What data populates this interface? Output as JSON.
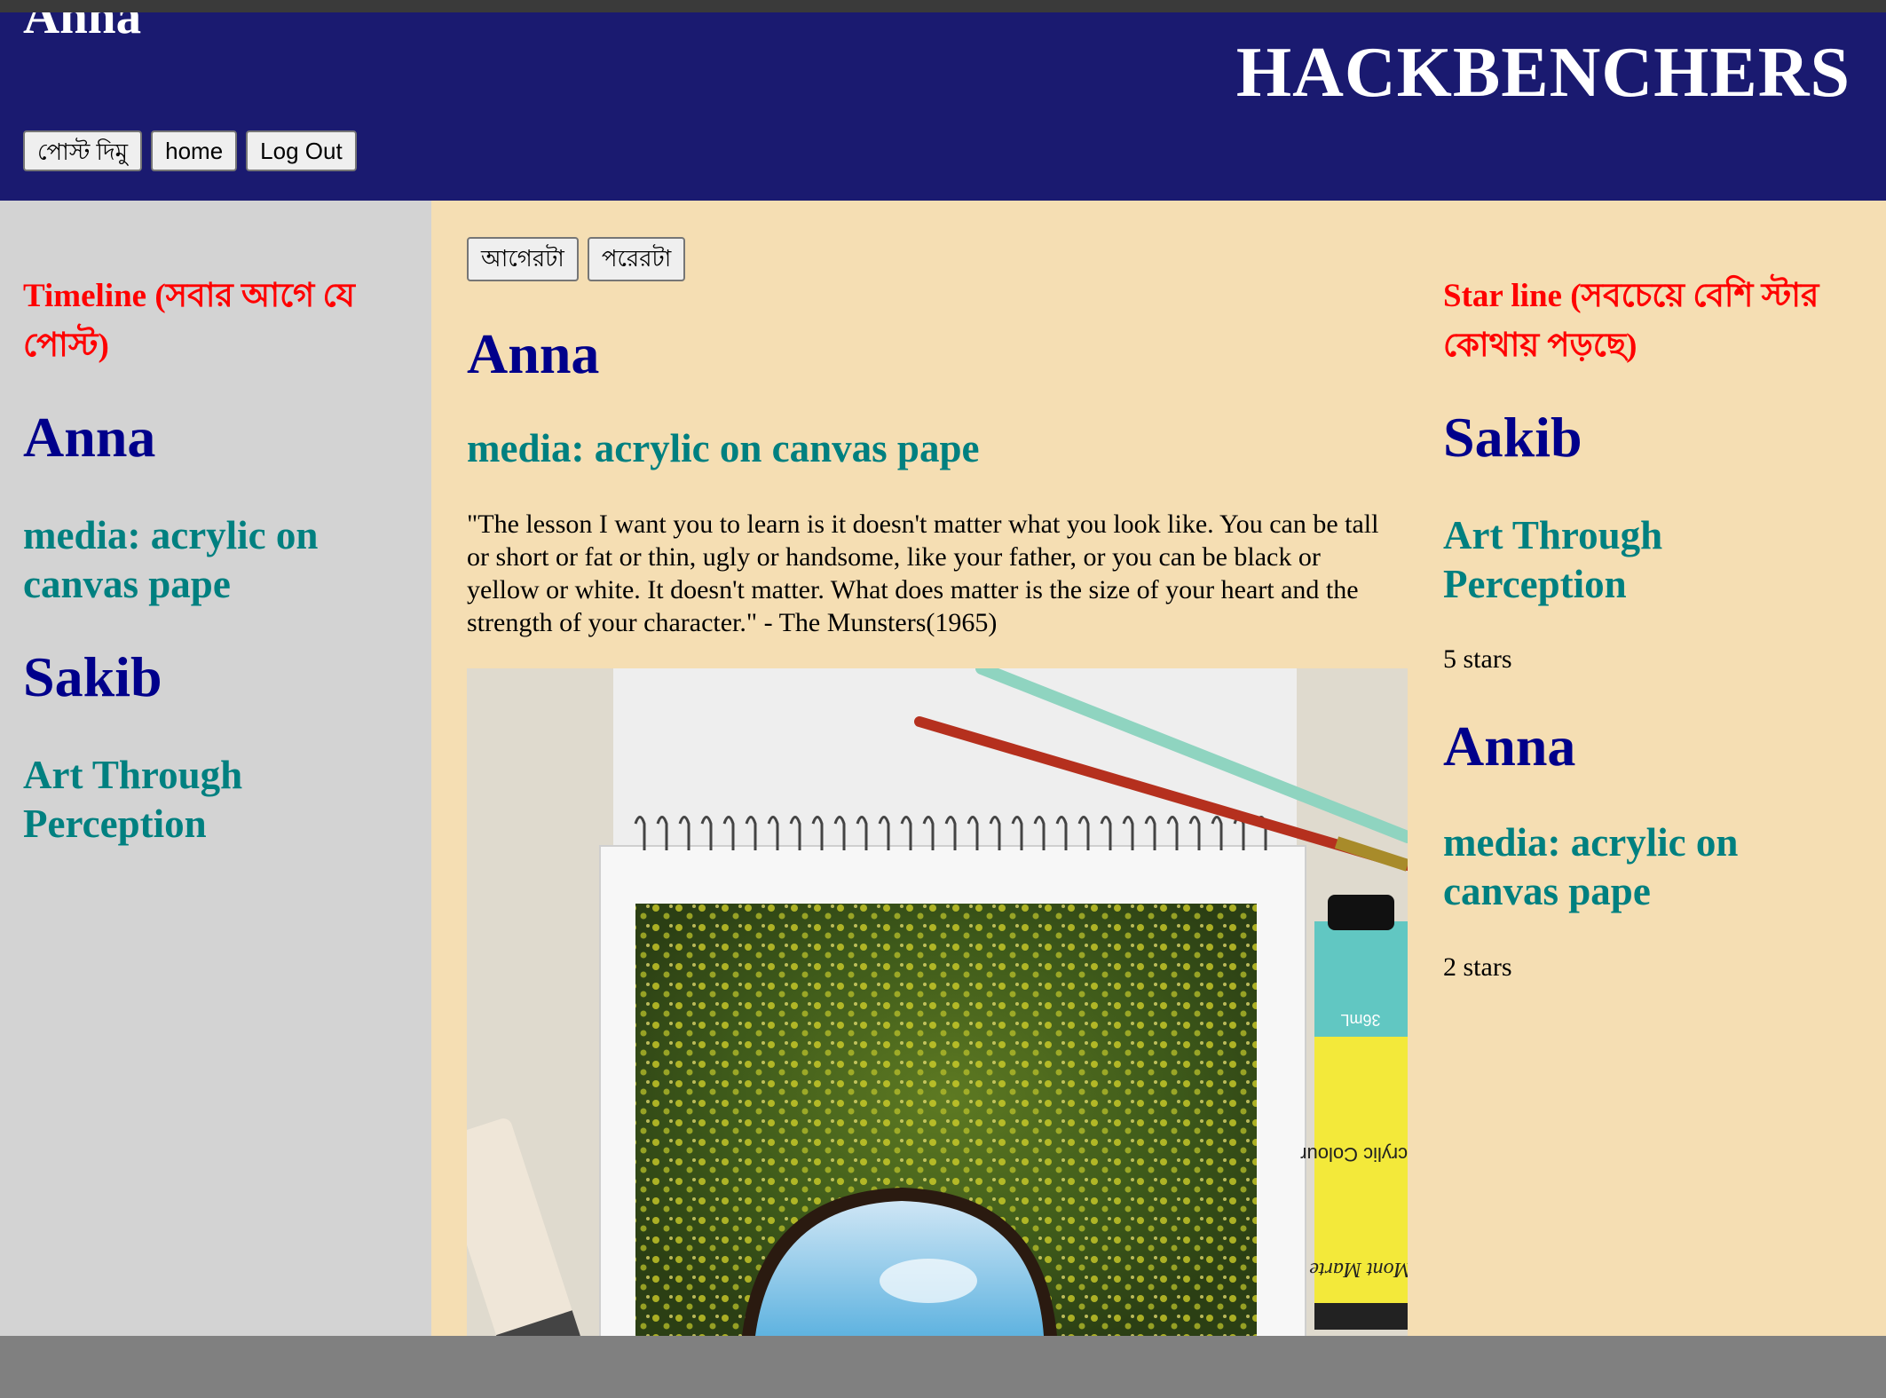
{
  "header": {
    "user_name": "Anna",
    "brand": "HACKBENCHERS",
    "nav": {
      "post": "পোস্ট দিমু",
      "home": "home",
      "logout": "Log Out"
    }
  },
  "timeline": {
    "heading": "Timeline (সবার আগে যে পোস্ট)",
    "items": [
      {
        "author": "Anna",
        "title": "media: acrylic on canvas pape"
      },
      {
        "author": "Sakib",
        "title": "Art Through Perception"
      }
    ]
  },
  "post": {
    "pager": {
      "prev": "আগেরটা",
      "next": "পরেরটা"
    },
    "author": "Anna",
    "title": "media: acrylic on canvas pape",
    "quote": "\"The lesson I want you to learn is it doesn't matter what you look like. You can be tall or short or fat or thin, ugly or handsome, like your father, or you can be black or yellow or white. It doesn't matter. What does matter is the size of your heart and the strength of your character.\" - The Munsters(1965)",
    "image": {
      "icon": "acrylic-painting-photo",
      "tube_label_1": "36mL",
      "tube_label_2": "Acrylic Colour",
      "tube_label_3": "Mont Marte"
    }
  },
  "starline": {
    "heading": "Star line (সবচেয়ে বেশি স্টার কোথায় পড়ছে)",
    "items": [
      {
        "author": "Sakib",
        "title": "Art Through Perception",
        "stars": "5 stars"
      },
      {
        "author": "Anna",
        "title": "media: acrylic on canvas pape",
        "stars": "2 stars"
      }
    ]
  },
  "colors": {
    "header_bg": "#1a1a70",
    "left_bg": "#d3d3d3",
    "center_bg": "#f5deb3",
    "heading_red": "#ff0000",
    "author_blue": "#00008b",
    "title_teal": "#008080"
  }
}
